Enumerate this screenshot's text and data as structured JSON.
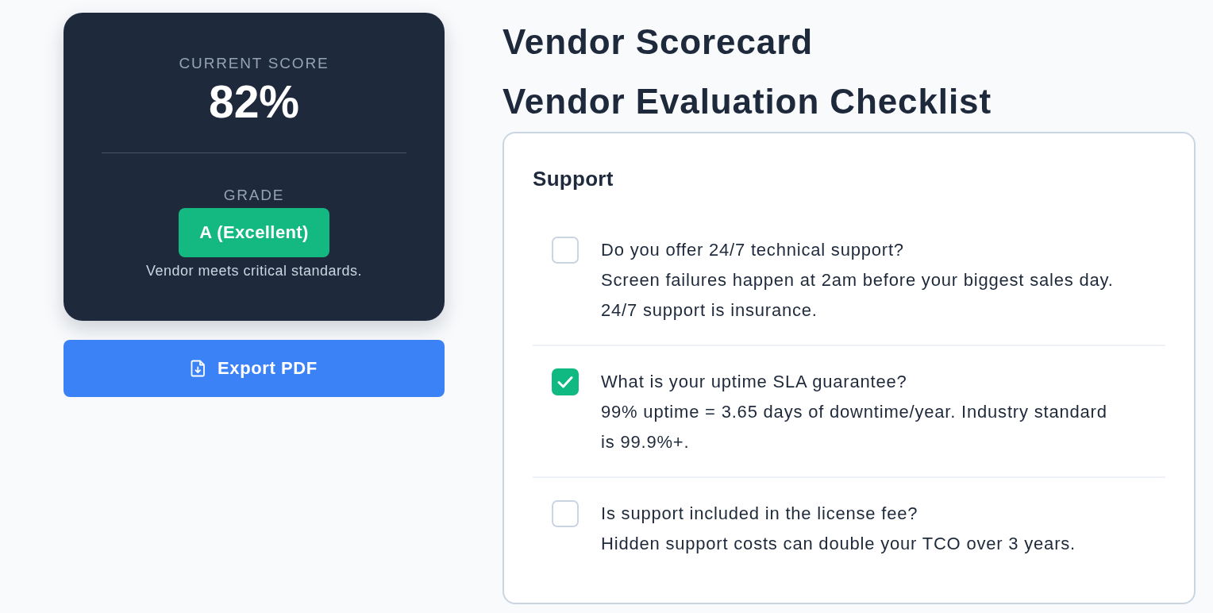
{
  "score_card": {
    "score_label": "CURRENT SCORE",
    "score": "82%",
    "grade_label": "GRADE",
    "grade": "A (Excellent)",
    "grade_note": "Vendor meets critical standards."
  },
  "export_button": {
    "label": "Export PDF"
  },
  "page": {
    "title": "Vendor Scorecard",
    "subtitle": "Vendor Evaluation Checklist"
  },
  "checklist": {
    "section": "Support",
    "items": [
      {
        "question": "Do you offer 24/7 technical support?",
        "hint": "Screen failures happen at 2am before your biggest sales day. 24/7 support is insurance.",
        "checked": false
      },
      {
        "question": "What is your uptime SLA guarantee?",
        "hint": "99% uptime = 3.65 days of downtime/year. Industry standard is 99.9%+.",
        "checked": true
      },
      {
        "question": "Is support included in the license fee?",
        "hint": "Hidden support costs can double your TCO over 3 years.",
        "checked": false
      }
    ]
  }
}
